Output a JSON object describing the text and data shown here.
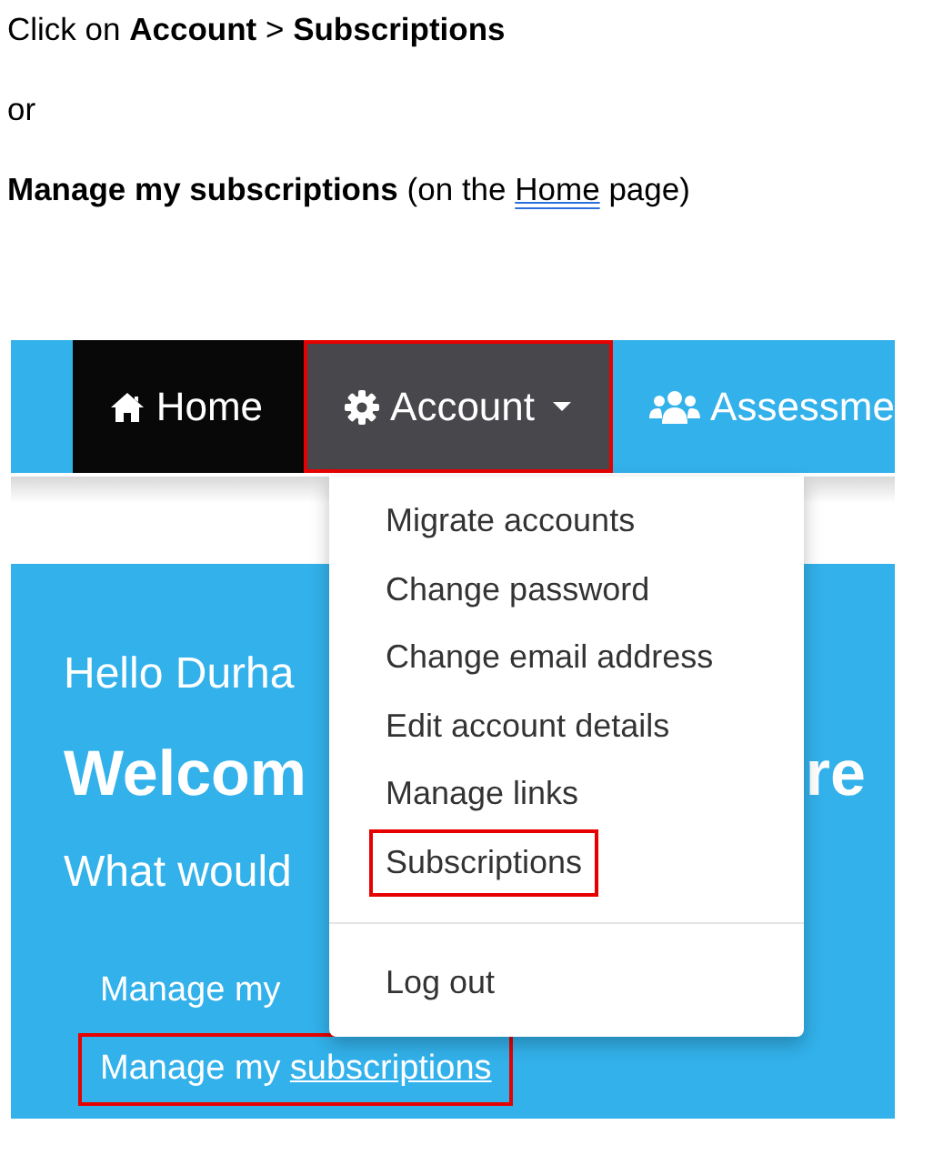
{
  "instructions": [
    {
      "text": "Click on **Account** > **Subscriptions**"
    },
    {
      "text": "or"
    },
    {
      "text": "**Manage my subscriptions** (on the ",
      "link": "Home",
      "after": " page)"
    }
  ],
  "screenshot": {
    "nav": [
      {
        "label": "Home",
        "kind": "home",
        "active": true,
        "open": false,
        "highlighted": false,
        "caret": false
      },
      {
        "label": "Account",
        "kind": "gear",
        "active": false,
        "open": true,
        "highlighted": true,
        "caret": true
      },
      {
        "label": "Assessme",
        "kind": "users",
        "active": false,
        "open": false,
        "highlighted": false,
        "caret": false
      }
    ],
    "hero": {
      "greeting": "Hello Durha",
      "welcome_left": "Welcom",
      "welcome_right": "re",
      "question": "What would",
      "links": [
        {
          "prefix": "Manage my",
          "highlighted": false
        },
        {
          "prefix": "Manage my",
          "link": "subscriptions",
          "highlighted": true
        }
      ]
    },
    "menu": {
      "items": [
        {
          "label": "Migrate accounts",
          "highlighted": false,
          "kind": "item"
        },
        {
          "label": "Change password",
          "highlighted": false,
          "kind": "item"
        },
        {
          "label": "Change email address",
          "highlighted": false,
          "kind": "item"
        },
        {
          "label": "Edit account details",
          "highlighted": false,
          "kind": "item"
        },
        {
          "label": "Manage links",
          "highlighted": false,
          "kind": "item"
        },
        {
          "label": "Subscriptions",
          "highlighted": true,
          "kind": "item"
        },
        {
          "kind": "divider"
        },
        {
          "label": "Log out",
          "highlighted": false,
          "kind": "item"
        }
      ]
    }
  }
}
